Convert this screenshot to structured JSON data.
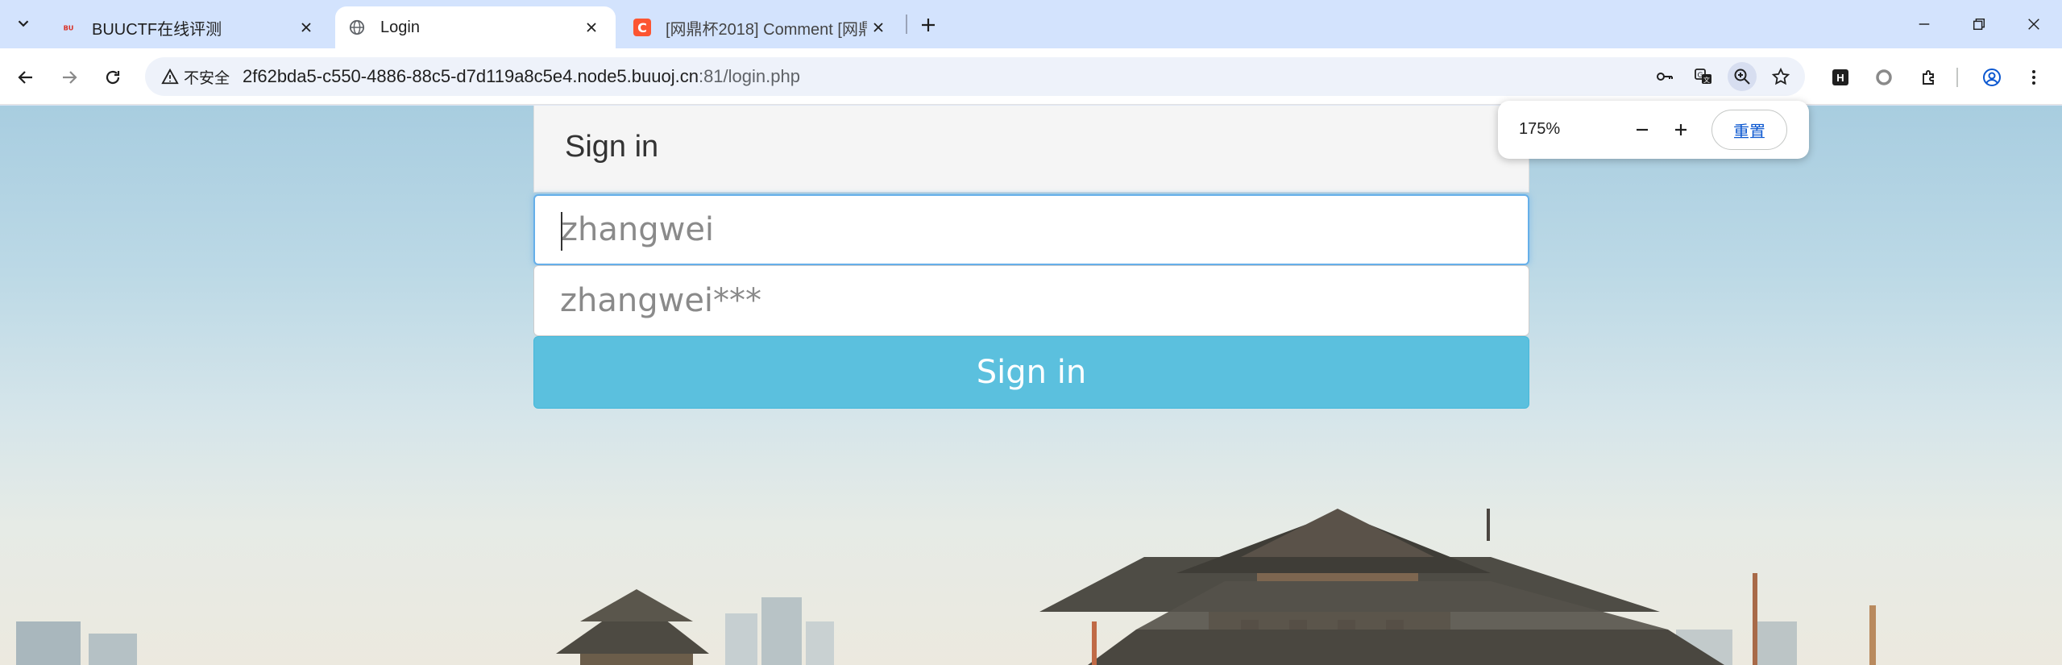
{
  "browser": {
    "tabs": [
      {
        "title": "BUUCTF在线评测",
        "favicon": "buuctf-logo-icon",
        "active": false
      },
      {
        "title": "Login",
        "favicon": "globe-icon",
        "active": true
      },
      {
        "title": "[网鼎杯2018] Comment [网鼎",
        "favicon": "csdn-logo-icon",
        "active": false
      }
    ],
    "security_label": "不安全",
    "url_host": "2f62bda5-c550-4886-88c5-d7d119a8c5e4.node5.buuoj.cn",
    "url_rest": ":81/login.php",
    "extension_label": "H"
  },
  "zoom": {
    "level": "175%",
    "reset_label": "重置"
  },
  "login": {
    "heading": "Sign in",
    "username_placeholder": "zhangwei",
    "password_placeholder": "zhangwei***",
    "submit_label": "Sign in"
  },
  "colors": {
    "tabstrip": "#d3e3fd",
    "button": "#5bc0de",
    "focus": "#66afe9"
  }
}
